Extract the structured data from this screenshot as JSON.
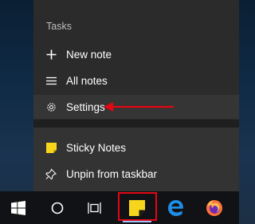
{
  "jumplist": {
    "section_title": "Tasks",
    "tasks": [
      {
        "label": "New note",
        "icon": "plus-icon"
      },
      {
        "label": "All notes",
        "icon": "list-icon"
      },
      {
        "label": "Settings",
        "icon": "gear-icon"
      }
    ],
    "app_actions": [
      {
        "label": "Sticky Notes",
        "icon": "sticky-notes-app-icon"
      },
      {
        "label": "Unpin from taskbar",
        "icon": "unpin-icon"
      }
    ]
  },
  "taskbar": {
    "buttons": [
      {
        "name": "start",
        "icon": "windows-logo-icon"
      },
      {
        "name": "cortana",
        "icon": "circle-search-icon"
      },
      {
        "name": "task-view",
        "icon": "task-view-icon"
      },
      {
        "name": "sticky-notes",
        "icon": "sticky-notes-icon"
      },
      {
        "name": "edge",
        "icon": "edge-icon"
      },
      {
        "name": "firefox",
        "icon": "firefox-icon"
      }
    ]
  },
  "colors": {
    "annotation_red": "#e30613",
    "sticky_yellow": "#f7d51d",
    "edge_blue": "#1e8fe6"
  }
}
